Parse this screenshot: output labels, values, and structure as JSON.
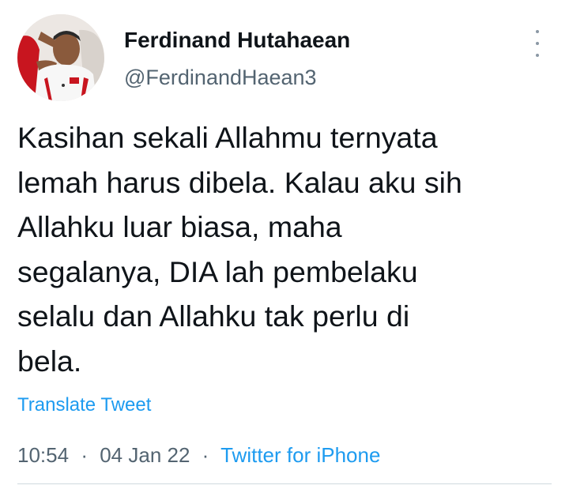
{
  "author": {
    "display_name": "Ferdinand Hutahaean",
    "handle": "@FerdinandHaean3",
    "avatar_icon": "profile-photo"
  },
  "tweet": {
    "lines": [
      "Kasihan sekali Allahmu ternyata",
      "lemah harus dibela. Kalau aku sih",
      "Allahku luar biasa, maha",
      "segalanya, DIA lah pembelaku",
      "selalu dan Allahku tak perlu di",
      "bela."
    ],
    "translate_label": "Translate Tweet",
    "time": "10:54",
    "date": "04 Jan 22",
    "separator": "·",
    "source": "Twitter for iPhone"
  },
  "menu_icon": "more-vertical-icon",
  "colors": {
    "text": "#0f1419",
    "secondary": "#536471",
    "link": "#1d9bf0",
    "divider": "#cfd9de"
  }
}
